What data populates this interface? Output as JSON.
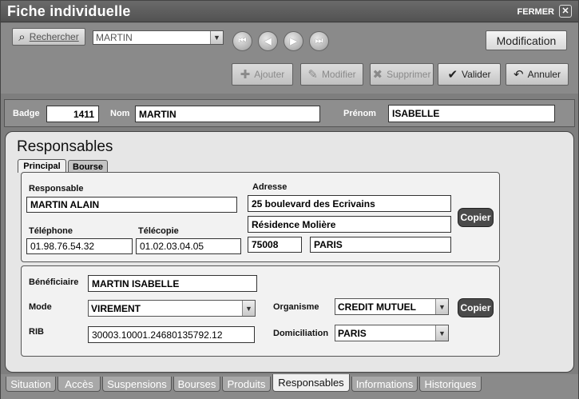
{
  "window": {
    "title": "Fiche individuelle",
    "close_label": "FERMER",
    "close_glyph": "✕"
  },
  "toolbar": {
    "search_label": "Rechercher",
    "name_select_value": "MARTIN",
    "mode_label": "Modification",
    "add_label": "Ajouter",
    "edit_label": "Modifier",
    "delete_label": "Supprimer",
    "validate_label": "Valider",
    "cancel_label": "Annuler",
    "nav": {
      "first": "⏮",
      "prev": "◀",
      "next": "▶",
      "last": "⏭"
    }
  },
  "identity": {
    "badge_label": "Badge",
    "badge_value": "1411",
    "nom_label": "Nom",
    "nom_value": "MARTIN",
    "prenom_label": "Prénom",
    "prenom_value": "ISABELLE"
  },
  "section": {
    "title": "Responsables"
  },
  "tabs": {
    "principal": "Principal",
    "bourse": "Bourse"
  },
  "responsable": {
    "responsable_label": "Responsable",
    "responsable_value": "MARTIN ALAIN",
    "adresse_label": "Adresse",
    "adresse_line1": "25 boulevard des Ecrivains",
    "adresse_line2": "Résidence Molière",
    "postal_code": "75008",
    "city": "PARIS",
    "telephone_label": "Téléphone",
    "telephone_value": "01.98.76.54.32",
    "telecopie_label": "Télécopie",
    "telecopie_value": "01.02.03.04.05",
    "copier_label": "Copier"
  },
  "beneficiaire": {
    "beneficiaire_label": "Bénéficiaire",
    "beneficiaire_value": "MARTIN ISABELLE",
    "mode_label": "Mode",
    "mode_value": "VIREMENT",
    "organisme_label": "Organisme",
    "organisme_value": "CREDIT MUTUEL",
    "rib_label": "RIB",
    "rib_value": "30003.10001.24680135792.12",
    "domiciliation_label": "Domiciliation",
    "domiciliation_value": "PARIS",
    "copier_label": "Copier"
  },
  "bottom_tabs": [
    "Situation",
    "Accès",
    "Suspensions",
    "Bourses",
    "Produits",
    "Responsables",
    "Informations",
    "Historiques"
  ]
}
